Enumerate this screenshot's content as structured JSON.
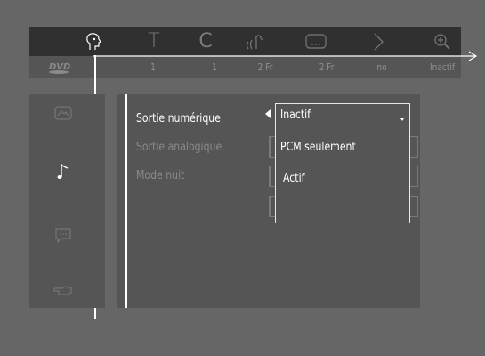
{
  "toolbar": {
    "icons": [
      "angle-icon",
      "title-icon",
      "chapter-icon",
      "audio-icon",
      "subtitle-icon",
      "repeat-icon",
      "zoom-icon"
    ],
    "title_letter": "T",
    "chapter_letter": "C"
  },
  "status": {
    "logo": "DVD",
    "title": "1",
    "chapter": "1",
    "audio": "2 Fr",
    "subtitle": "2 Fr",
    "repeat": "no",
    "zoom": "Inactif"
  },
  "sidebar": {
    "items": [
      "picture-icon",
      "music-note-icon",
      "speech-bubble-icon",
      "hand-pointer-icon"
    ],
    "selected": "music-note-icon"
  },
  "menu": {
    "items": [
      {
        "label": "Sortie numérique",
        "state": "active"
      },
      {
        "label": "Sortie analogique",
        "state": "inactive"
      },
      {
        "label": "Mode nuit",
        "state": "inactive"
      }
    ]
  },
  "dropdown": {
    "current": "Inactif",
    "options": [
      "PCM seulement",
      "Actif"
    ]
  },
  "colors": {
    "background": "#666666",
    "topbar": "#303030",
    "panel": "#555555",
    "highlight": "#ffffff",
    "dim_text": "#8a8a8a"
  }
}
